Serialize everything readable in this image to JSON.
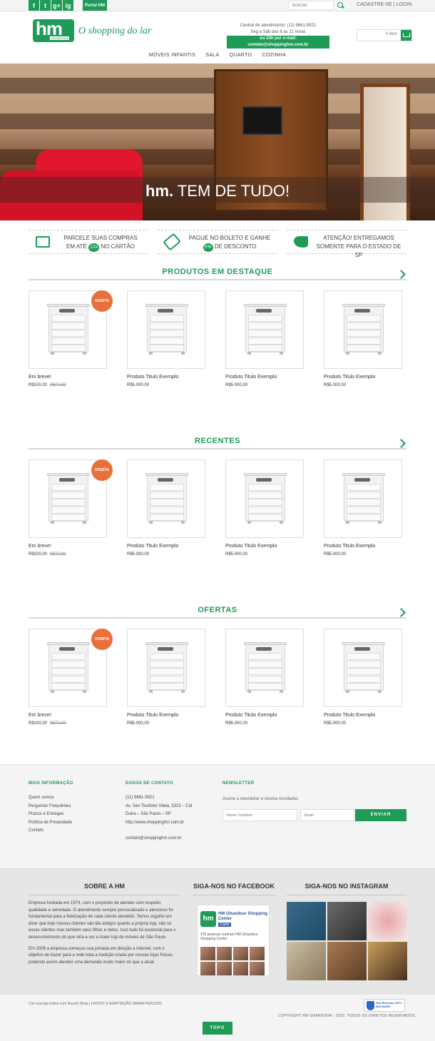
{
  "topbar": {
    "social": [
      "f",
      "t",
      "g+",
      "ig"
    ],
    "portal": "Portal HM",
    "search_placeholder": "BUSCAR",
    "account_links": "CADASTRE-SE | LOGIN"
  },
  "header": {
    "logo_text": "hm",
    "logo_brand": "GHANDOUR",
    "slogan": "O shopping do lar",
    "central_line1": "Central de atendimento: (11) 5661-9921",
    "central_line2": "Seg a Sáb das 8 as 21 horas",
    "central_line3": "ou 24h por e-mail: contato@shoppinghm.com.br",
    "cart_label": "0 item"
  },
  "nav": [
    "MÓVEIS INFANTIS",
    "SALA",
    "QUARTO",
    "COZINHA"
  ],
  "hero": {
    "brand": "hm.",
    "tagline": "TEM DE TUDO!"
  },
  "features": [
    {
      "line1": "PARCELE SUAS COMPRAS",
      "line2a": "EM ATÉ",
      "badge": "12x",
      "line2b": "NO CARTÃO"
    },
    {
      "line1": "PAGUE NO BOLETO E GANHE",
      "line2a": "",
      "badge": "5%",
      "line2b": "DE DESCONTO"
    },
    {
      "line1": "ATENÇÃO! ENTREGAMOS",
      "line2a": "SOMENTE PARA O ESTADO DE SP",
      "badge": "",
      "line2b": ""
    }
  ],
  "sections": [
    {
      "title": "PRODUTOS EM DESTAQUE",
      "products": [
        {
          "name": "Em breve!",
          "price": "R$100,00",
          "old_price": "R$72,90",
          "badge": "OFERTA"
        },
        {
          "name": "Produto Titulo Exemplo",
          "price": "R$5.000,00",
          "old_price": "",
          "badge": ""
        },
        {
          "name": "Produto Titulo Exemplo",
          "price": "R$5.000,00",
          "old_price": "",
          "badge": ""
        },
        {
          "name": "Produto Titulo Exemplo",
          "price": "R$5.000,00",
          "old_price": "",
          "badge": ""
        }
      ]
    },
    {
      "title": "RECENTES",
      "products": [
        {
          "name": "Em breve!",
          "price": "R$100,00",
          "old_price": "R$72,90",
          "badge": "OFERTA"
        },
        {
          "name": "Produto Titulo Exemplo",
          "price": "R$5.000,00",
          "old_price": "",
          "badge": ""
        },
        {
          "name": "Produto Titulo Exemplo",
          "price": "R$5.000,00",
          "old_price": "",
          "badge": ""
        },
        {
          "name": "Produto Titulo Exemplo",
          "price": "R$5.000,00",
          "old_price": "",
          "badge": ""
        }
      ]
    },
    {
      "title": "OFERTAS",
      "products": [
        {
          "name": "Em breve!",
          "price": "R$100,00",
          "old_price": "R$72,90",
          "badge": "OFERTA"
        },
        {
          "name": "Produto Titulo Exemplo",
          "price": "R$5.000,00",
          "old_price": "",
          "badge": ""
        },
        {
          "name": "Produto Titulo Exemplo",
          "price": "R$5.000,00",
          "old_price": "",
          "badge": ""
        },
        {
          "name": "Produto Titulo Exemplo",
          "price": "R$5.000,00",
          "old_price": "",
          "badge": ""
        }
      ]
    }
  ],
  "footer": {
    "info_title": "MAIS INFORMAÇÃO",
    "info_links": [
      "Quem somos",
      "Perguntas Frequêntes",
      "Prazos e Entregas",
      "Política de Privacidade",
      "Contato"
    ],
    "contact_title": "DADOS DE CONTATO",
    "contact_phone": "(11) 5661-9921",
    "contact_addr1": "Av. Sen Teotônio Vilela, 3323 – Cid",
    "contact_addr2": "Dutra – São Paulo – SP",
    "contact_site": "http://www.shoppinghm.com.br",
    "contact_email": "contato@shoppinghm.com.br",
    "newsletter_title": "NEWSLETTER",
    "newsletter_text": "Assine a newsletter e receba novidades",
    "name_placeholder": "Nome Completo",
    "email_placeholder": "Email",
    "send_label": "ENVIAR"
  },
  "bottom": {
    "about_title": "SOBRE A HM",
    "about_p1": "Empresa fundada em 1974, com o propósito de atender com respeito, qualidade e seriedade. O atendimento sempre personalizado e atencioso foi fundamental para a fidelização de cada cliente atendido. Temos orgulho em dizer que hoje nossos clientes são tão antigos quanto a própria loja, não só esses clientes mas também seus filhos e netos. Isso tudo foi essencial para o desenvolvimento do que viria a ser a maior loja de móveis de São Paulo.",
    "about_p2": "Em 2009 a empresa começou sua jornada em direção a internet, com o objetivo de trazer para a rede toda a tradição criada por nossas lojas físicas, podendo assim atender uma demanda muito maior do que a atual.",
    "fb_title": "SIGA-NOS NO FACEBOOK",
    "fb_page_name": "HM Ghandour Shopping Center",
    "fb_like": "Curtir",
    "fb_count": "378 pessoas curtiram HM Ghandour Shopping Center.",
    "insta_title": "SIGA-NOS NO INSTAGRAM",
    "credits": "Crie sua loja online com Nuvem Shop | LAYOUT E ADAPTAÇÃO: MAIRA PERUZZO",
    "copyright": "COPYRIGHT HM GHANDOUR - 2015. TODOS OS DIREITOS RESERVADOS.",
    "site_badge": "Site Blindado ANTI-MALWARE",
    "top_button": "TOPO"
  },
  "colors": {
    "brand": "#1d9b57",
    "offer": "#e8713b"
  }
}
